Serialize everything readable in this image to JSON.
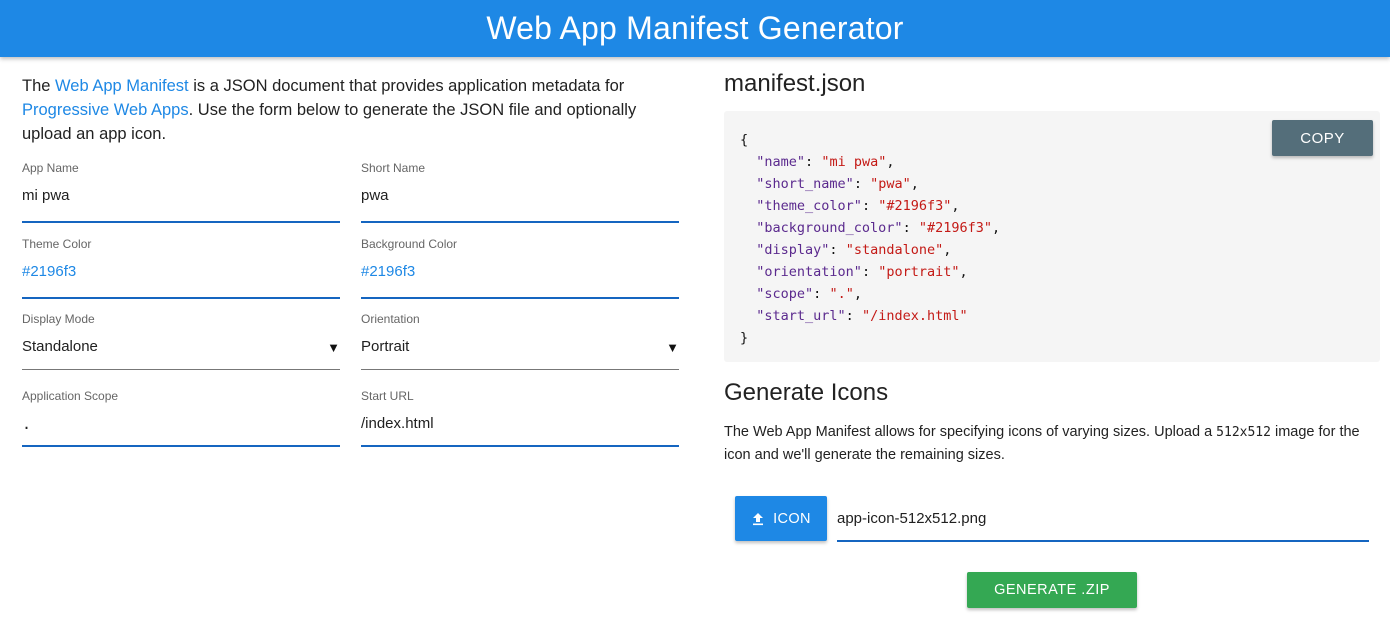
{
  "header": {
    "title": "Web App Manifest Generator"
  },
  "intro": {
    "t1": "The ",
    "link1": "Web App Manifest",
    "t2": " is a JSON document that provides application metadata for ",
    "link2": "Progressive Web Apps",
    "t3": ". Use the form below to generate the JSON file and optionally upload an app icon."
  },
  "form": {
    "app_name": {
      "label": "App Name",
      "value": "mi pwa"
    },
    "short_name": {
      "label": "Short Name",
      "value": "pwa"
    },
    "theme_color": {
      "label": "Theme Color",
      "value": "#2196f3"
    },
    "background_color": {
      "label": "Background Color",
      "value": "#2196f3"
    },
    "display_mode": {
      "label": "Display Mode",
      "value": "Standalone"
    },
    "orientation": {
      "label": "Orientation",
      "value": "Portrait"
    },
    "scope": {
      "label": "Application Scope",
      "value": "."
    },
    "start_url": {
      "label": "Start URL",
      "value": "/index.html"
    }
  },
  "manifest": {
    "title": "manifest.json",
    "copy_label": "COPY",
    "open_brace": "{",
    "close_brace": "}",
    "lines": [
      {
        "key": "\"name\"",
        "value": "\"mi pwa\""
      },
      {
        "key": "\"short_name\"",
        "value": "\"pwa\""
      },
      {
        "key": "\"theme_color\"",
        "value": "\"#2196f3\""
      },
      {
        "key": "\"background_color\"",
        "value": "\"#2196f3\""
      },
      {
        "key": "\"display\"",
        "value": "\"standalone\""
      },
      {
        "key": "\"orientation\"",
        "value": "\"portrait\""
      },
      {
        "key": "\"scope\"",
        "value": "\".\""
      },
      {
        "key": "\"start_url\"",
        "value": "\"/index.html\""
      }
    ]
  },
  "icons": {
    "title": "Generate Icons",
    "desc1": "The Web App Manifest allows for specifying icons of varying sizes. Upload a ",
    "desc_code": "512x512",
    "desc2": " image for the icon and we'll generate the remaining sizes.",
    "upload_label": "ICON",
    "filename": "app-icon-512x512.png",
    "generate_label": "GENERATE .ZIP"
  },
  "colors": {
    "primary": "#1e88e5",
    "copy": "#546e7a",
    "generate": "#34a853"
  }
}
